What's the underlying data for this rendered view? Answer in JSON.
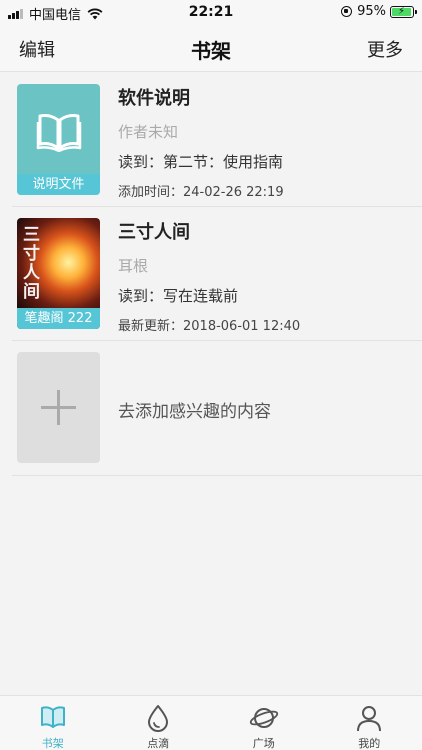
{
  "status": {
    "carrier": "中国电信",
    "time": "22:21",
    "battery": "95%",
    "battery_level": 0.95
  },
  "nav": {
    "edit": "编辑",
    "title": "书架",
    "more": "更多"
  },
  "books": [
    {
      "title": "软件说明",
      "author": "作者未知",
      "progress": "读到：第二节：使用指南",
      "time": "添加时间：24-02-26 22:19",
      "tag": "说明文件",
      "cover_icon": "open-book-icon",
      "cover_color": "#6bc3c4"
    },
    {
      "title": "三寸人间",
      "author": "耳根",
      "progress": "读到：写在连载前",
      "time": "最新更新：2018-06-01 12:40",
      "tag": "笔趣阁 222",
      "cover_title": "三寸人间"
    }
  ],
  "add": {
    "label": "去添加感兴趣的内容"
  },
  "tabs": [
    {
      "label": "书架",
      "icon": "book-icon",
      "active": true
    },
    {
      "label": "点滴",
      "icon": "drop-icon",
      "active": false
    },
    {
      "label": "广场",
      "icon": "planet-icon",
      "active": false
    },
    {
      "label": "我的",
      "icon": "person-icon",
      "active": false
    }
  ],
  "colors": {
    "accent": "#3fb2c7",
    "tag": "#56c6d6"
  }
}
